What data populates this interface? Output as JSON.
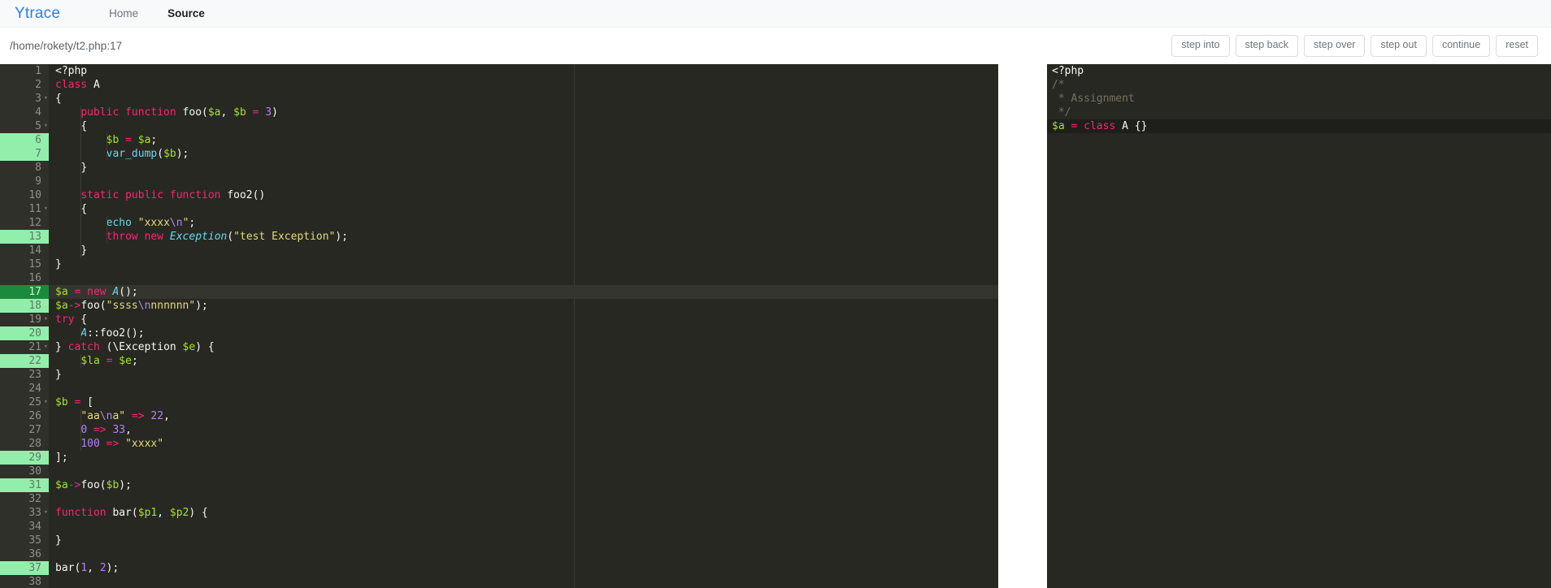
{
  "navbar": {
    "brand": "Ytrace",
    "links": [
      {
        "label": "Home",
        "active": false
      },
      {
        "label": "Source",
        "active": true
      }
    ]
  },
  "subbar": {
    "filepath": "/home/rokety/t2.php:17",
    "buttons": [
      {
        "label": "step into",
        "name": "step-into-button"
      },
      {
        "label": "step back",
        "name": "step-back-button"
      },
      {
        "label": "step over",
        "name": "step-over-button"
      },
      {
        "label": "step out",
        "name": "step-out-button"
      },
      {
        "label": "continue",
        "name": "continue-button"
      },
      {
        "label": "reset",
        "name": "reset-button"
      }
    ]
  },
  "editor": {
    "language": "php",
    "current_line": 17,
    "breakpoint_lines": [
      6,
      7,
      13,
      17,
      18,
      20,
      22,
      29,
      31,
      37
    ],
    "fold_lines": [
      3,
      5,
      11,
      19,
      21,
      25,
      33
    ],
    "total_lines": 38,
    "lines": [
      {
        "n": 1,
        "tokens": [
          {
            "t": "tag",
            "s": "<?php"
          }
        ]
      },
      {
        "n": 2,
        "tokens": [
          {
            "t": "kw",
            "s": "class"
          },
          {
            "t": "plain",
            "s": " A"
          }
        ]
      },
      {
        "n": 3,
        "tokens": [
          {
            "t": "punct",
            "s": "{"
          }
        ]
      },
      {
        "n": 4,
        "tokens": [
          {
            "t": "plain",
            "s": "    "
          },
          {
            "t": "kw",
            "s": "public function"
          },
          {
            "t": "plain",
            "s": " foo("
          },
          {
            "t": "var",
            "s": "$a"
          },
          {
            "t": "plain",
            "s": ", "
          },
          {
            "t": "var",
            "s": "$b"
          },
          {
            "t": "plain",
            "s": " "
          },
          {
            "t": "op",
            "s": "="
          },
          {
            "t": "plain",
            "s": " "
          },
          {
            "t": "num",
            "s": "3"
          },
          {
            "t": "plain",
            "s": ")"
          }
        ]
      },
      {
        "n": 5,
        "tokens": [
          {
            "t": "plain",
            "s": "    "
          },
          {
            "t": "punct",
            "s": "{"
          }
        ]
      },
      {
        "n": 6,
        "tokens": [
          {
            "t": "plain",
            "s": "        "
          },
          {
            "t": "var",
            "s": "$b"
          },
          {
            "t": "plain",
            "s": " "
          },
          {
            "t": "op",
            "s": "="
          },
          {
            "t": "plain",
            "s": " "
          },
          {
            "t": "var",
            "s": "$a"
          },
          {
            "t": "plain",
            "s": ";"
          }
        ]
      },
      {
        "n": 7,
        "tokens": [
          {
            "t": "plain",
            "s": "        "
          },
          {
            "t": "fn",
            "s": "var_dump"
          },
          {
            "t": "plain",
            "s": "("
          },
          {
            "t": "var",
            "s": "$b"
          },
          {
            "t": "plain",
            "s": ");"
          }
        ]
      },
      {
        "n": 8,
        "tokens": [
          {
            "t": "plain",
            "s": "    "
          },
          {
            "t": "punct",
            "s": "}"
          }
        ]
      },
      {
        "n": 9,
        "tokens": []
      },
      {
        "n": 10,
        "tokens": [
          {
            "t": "plain",
            "s": "    "
          },
          {
            "t": "kw",
            "s": "static public function"
          },
          {
            "t": "plain",
            "s": " foo2()"
          }
        ]
      },
      {
        "n": 11,
        "tokens": [
          {
            "t": "plain",
            "s": "    "
          },
          {
            "t": "punct",
            "s": "{"
          }
        ]
      },
      {
        "n": 12,
        "tokens": [
          {
            "t": "plain",
            "s": "        "
          },
          {
            "t": "fn",
            "s": "echo"
          },
          {
            "t": "plain",
            "s": " "
          },
          {
            "t": "str",
            "s": "\"xxxx"
          },
          {
            "t": "esc",
            "s": "\\n"
          },
          {
            "t": "str",
            "s": "\""
          },
          {
            "t": "plain",
            "s": ";"
          }
        ]
      },
      {
        "n": 13,
        "tokens": [
          {
            "t": "plain",
            "s": "        "
          },
          {
            "t": "kw",
            "s": "throw new"
          },
          {
            "t": "plain",
            "s": " "
          },
          {
            "t": "cls",
            "s": "Exception"
          },
          {
            "t": "plain",
            "s": "("
          },
          {
            "t": "str",
            "s": "\"test Exception\""
          },
          {
            "t": "plain",
            "s": ");"
          }
        ]
      },
      {
        "n": 14,
        "tokens": [
          {
            "t": "plain",
            "s": "    "
          },
          {
            "t": "punct",
            "s": "}"
          }
        ]
      },
      {
        "n": 15,
        "tokens": [
          {
            "t": "punct",
            "s": "}"
          }
        ]
      },
      {
        "n": 16,
        "tokens": []
      },
      {
        "n": 17,
        "tokens": [
          {
            "t": "var",
            "s": "$a"
          },
          {
            "t": "plain",
            "s": " "
          },
          {
            "t": "op",
            "s": "="
          },
          {
            "t": "plain",
            "s": " "
          },
          {
            "t": "kw",
            "s": "new"
          },
          {
            "t": "plain",
            "s": " "
          },
          {
            "t": "cls",
            "s": "A"
          },
          {
            "t": "plain",
            "s": "();"
          }
        ]
      },
      {
        "n": 18,
        "tokens": [
          {
            "t": "var",
            "s": "$a"
          },
          {
            "t": "op",
            "s": "->"
          },
          {
            "t": "plain",
            "s": "foo("
          },
          {
            "t": "str",
            "s": "\"ssss"
          },
          {
            "t": "esc",
            "s": "\\n"
          },
          {
            "t": "str",
            "s": "nnnnnn\""
          },
          {
            "t": "plain",
            "s": ");"
          }
        ]
      },
      {
        "n": 19,
        "tokens": [
          {
            "t": "kw",
            "s": "try"
          },
          {
            "t": "plain",
            "s": " {"
          }
        ]
      },
      {
        "n": 20,
        "tokens": [
          {
            "t": "plain",
            "s": "    "
          },
          {
            "t": "cls",
            "s": "A"
          },
          {
            "t": "plain",
            "s": "::foo2();"
          }
        ]
      },
      {
        "n": 21,
        "tokens": [
          {
            "t": "plain",
            "s": "} "
          },
          {
            "t": "kw",
            "s": "catch"
          },
          {
            "t": "plain",
            "s": " (\\Exception "
          },
          {
            "t": "var",
            "s": "$e"
          },
          {
            "t": "plain",
            "s": ") {"
          }
        ]
      },
      {
        "n": 22,
        "tokens": [
          {
            "t": "plain",
            "s": "    "
          },
          {
            "t": "var",
            "s": "$la"
          },
          {
            "t": "plain",
            "s": " "
          },
          {
            "t": "op",
            "s": "="
          },
          {
            "t": "plain",
            "s": " "
          },
          {
            "t": "var",
            "s": "$e"
          },
          {
            "t": "plain",
            "s": ";"
          }
        ]
      },
      {
        "n": 23,
        "tokens": [
          {
            "t": "punct",
            "s": "}"
          }
        ]
      },
      {
        "n": 24,
        "tokens": []
      },
      {
        "n": 25,
        "tokens": [
          {
            "t": "var",
            "s": "$b"
          },
          {
            "t": "plain",
            "s": " "
          },
          {
            "t": "op",
            "s": "="
          },
          {
            "t": "plain",
            "s": " ["
          }
        ]
      },
      {
        "n": 26,
        "tokens": [
          {
            "t": "plain",
            "s": "    "
          },
          {
            "t": "str",
            "s": "\"aa"
          },
          {
            "t": "esc",
            "s": "\\n"
          },
          {
            "t": "str",
            "s": "a\""
          },
          {
            "t": "plain",
            "s": " "
          },
          {
            "t": "op",
            "s": "=>"
          },
          {
            "t": "plain",
            "s": " "
          },
          {
            "t": "num",
            "s": "22"
          },
          {
            "t": "plain",
            "s": ","
          }
        ]
      },
      {
        "n": 27,
        "tokens": [
          {
            "t": "plain",
            "s": "    "
          },
          {
            "t": "num",
            "s": "0"
          },
          {
            "t": "plain",
            "s": " "
          },
          {
            "t": "op",
            "s": "=>"
          },
          {
            "t": "plain",
            "s": " "
          },
          {
            "t": "num",
            "s": "33"
          },
          {
            "t": "plain",
            "s": ","
          }
        ]
      },
      {
        "n": 28,
        "tokens": [
          {
            "t": "plain",
            "s": "    "
          },
          {
            "t": "num",
            "s": "100"
          },
          {
            "t": "plain",
            "s": " "
          },
          {
            "t": "op",
            "s": "=>"
          },
          {
            "t": "plain",
            "s": " "
          },
          {
            "t": "str",
            "s": "\"xxxx\""
          }
        ]
      },
      {
        "n": 29,
        "tokens": [
          {
            "t": "plain",
            "s": "];"
          }
        ]
      },
      {
        "n": 30,
        "tokens": []
      },
      {
        "n": 31,
        "tokens": [
          {
            "t": "var",
            "s": "$a"
          },
          {
            "t": "op",
            "s": "->"
          },
          {
            "t": "plain",
            "s": "foo("
          },
          {
            "t": "var",
            "s": "$b"
          },
          {
            "t": "plain",
            "s": ");"
          }
        ]
      },
      {
        "n": 32,
        "tokens": []
      },
      {
        "n": 33,
        "tokens": [
          {
            "t": "kw",
            "s": "function"
          },
          {
            "t": "plain",
            "s": " bar("
          },
          {
            "t": "var",
            "s": "$p1"
          },
          {
            "t": "plain",
            "s": ", "
          },
          {
            "t": "var",
            "s": "$p2"
          },
          {
            "t": "plain",
            "s": ") {"
          }
        ]
      },
      {
        "n": 34,
        "tokens": []
      },
      {
        "n": 35,
        "tokens": [
          {
            "t": "punct",
            "s": "}"
          }
        ]
      },
      {
        "n": 36,
        "tokens": []
      },
      {
        "n": 37,
        "tokens": [
          {
            "t": "plain",
            "s": "bar("
          },
          {
            "t": "num",
            "s": "1"
          },
          {
            "t": "plain",
            "s": ", "
          },
          {
            "t": "num",
            "s": "2"
          },
          {
            "t": "plain",
            "s": ");"
          }
        ]
      },
      {
        "n": 38,
        "tokens": []
      }
    ]
  },
  "panel": {
    "title": "Assignment",
    "active_line": 5,
    "lines": [
      {
        "n": 1,
        "tokens": [
          {
            "t": "tag",
            "s": "<?php"
          }
        ]
      },
      {
        "n": 2,
        "tokens": [
          {
            "t": "com",
            "s": "/*"
          }
        ]
      },
      {
        "n": 3,
        "tokens": [
          {
            "t": "com",
            "s": " * Assignment"
          }
        ]
      },
      {
        "n": 4,
        "tokens": [
          {
            "t": "com",
            "s": " */"
          }
        ]
      },
      {
        "n": 5,
        "tokens": [
          {
            "t": "var",
            "s": "$a"
          },
          {
            "t": "plain",
            "s": " "
          },
          {
            "t": "op",
            "s": "="
          },
          {
            "t": "plain",
            "s": " "
          },
          {
            "t": "kw",
            "s": "class"
          },
          {
            "t": "plain",
            "s": " A {}"
          }
        ]
      }
    ]
  },
  "colors": {
    "brand": "#2a7ef0",
    "editor_bg": "#272822",
    "gutter_bg": "#2f302a",
    "breakpoint_green": "#92eeab",
    "current_green": "#1b8a3c",
    "active_line_bg": "#34352f"
  }
}
